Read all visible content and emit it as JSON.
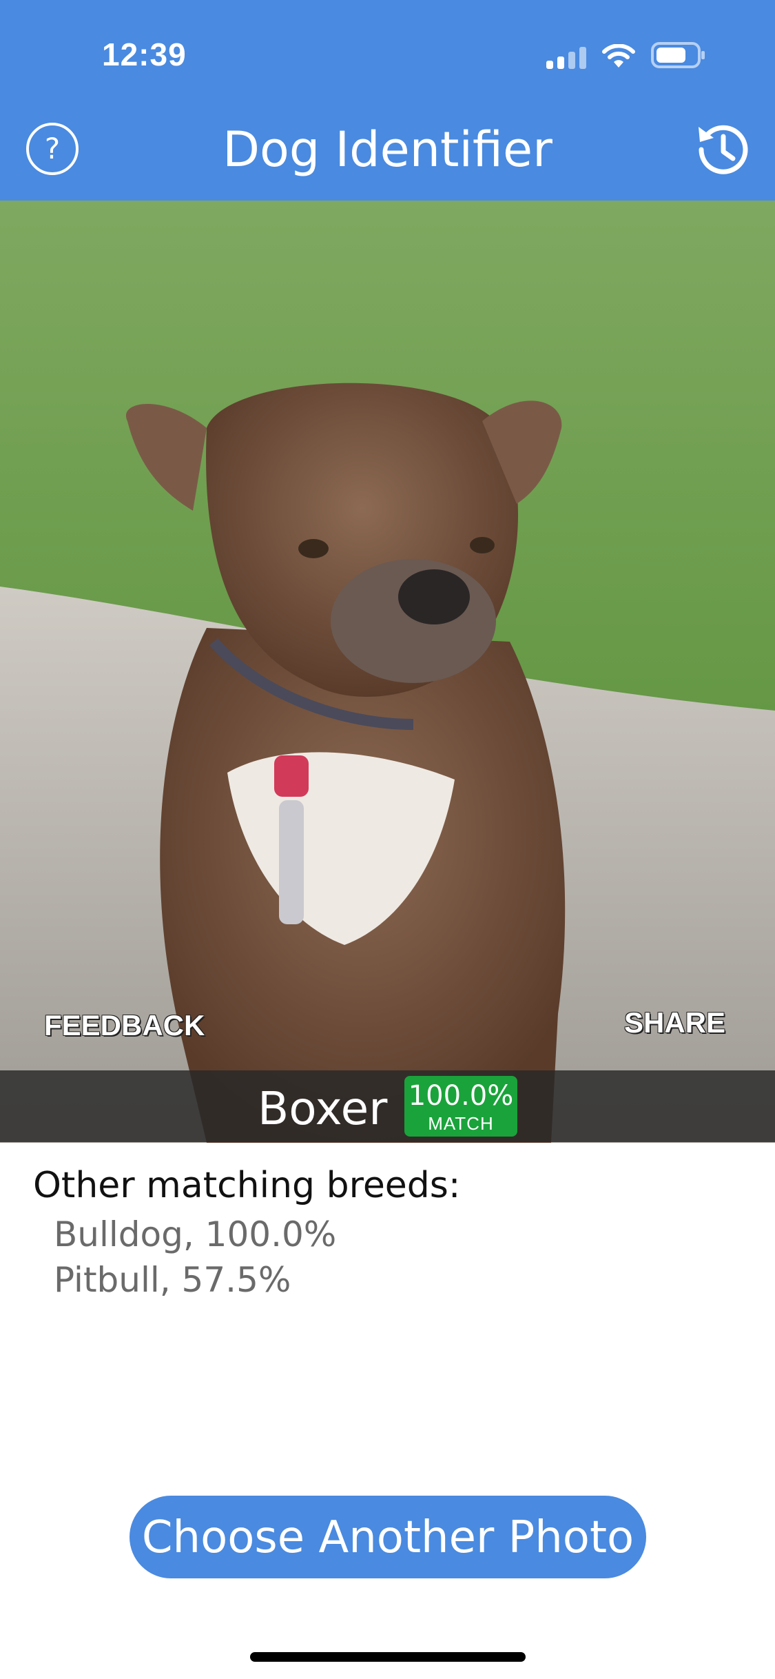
{
  "status_bar": {
    "time": "12:39"
  },
  "header": {
    "title": "Dog Identifier",
    "help_icon": "question-circle-icon",
    "history_icon": "history-clock-icon"
  },
  "photo": {
    "description_icon": "dog-photo",
    "feedback_label": "FEEDBACK",
    "share_label": "SHARE"
  },
  "result": {
    "breed": "Boxer",
    "match_percent": "100.0%",
    "match_label": "MATCH"
  },
  "other_matches": {
    "title": "Other matching breeds:",
    "items": [
      {
        "label": "Bulldog, 100.0%"
      },
      {
        "label": "Pitbull, 57.5%"
      }
    ]
  },
  "actions": {
    "choose_another": "Choose Another Photo"
  },
  "colors": {
    "brand": "#4a8ae0",
    "match_green": "#1aa33a"
  }
}
